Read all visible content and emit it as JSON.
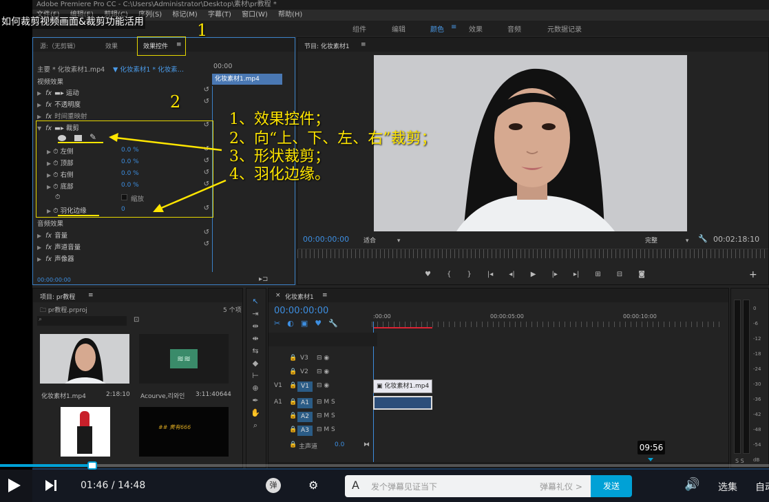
{
  "video_title": "如何裁剪视频画面&裁剪功能活用",
  "premiere": {
    "title": "Adobe Premiere Pro CC - C:\\Users\\Administrator\\Desktop\\素材\\pr教程 *",
    "menus": [
      "文件(F)",
      "编辑(E)",
      "剪辑(C)",
      "序列(S)",
      "标记(M)",
      "字幕(T)",
      "窗口(W)",
      "帮助(H)"
    ],
    "workspaces": [
      "组件",
      "编辑",
      "颜色",
      "≡",
      "效果",
      "音频",
      "元数据记录"
    ],
    "top_left_tabs": {
      "source": "源:（无剪辑）",
      "effects": "效果",
      "effect_controls": "效果控件",
      "menu": "≡"
    },
    "ec": {
      "master": "主要 * 化妆素材1.mp4",
      "clip": "▼ 化妆素材1 * 化妆素…",
      "time": "00:00",
      "clip_bar": "化妆素材1.mp4",
      "video_effects": "视频效果",
      "motion": "运动",
      "opacity": "不透明度",
      "time_remap": "时间重映射",
      "crop": "裁剪",
      "left": "左侧",
      "left_val": "0.0 %",
      "top": "顶部",
      "top_val": "0.0 %",
      "right": "右侧",
      "right_val": "0.0 %",
      "bottom": "底部",
      "bottom_val": "0.0 %",
      "zoom": "缩放",
      "feather": "羽化边缘",
      "feather_val": "0",
      "audio_effects": "音频效果",
      "volume": "音量",
      "channel_volume": "声道音量",
      "panner": "声像器",
      "timecode": "00:00:00:00",
      "fx": "fx"
    },
    "program": {
      "title": "节目: 化妆素材1",
      "menu": "≡",
      "timecode": "00:00:00:00",
      "fit": "适合",
      "quality": "完整",
      "duration": "00:02:18:10",
      "transport": [
        "♥",
        "{",
        "}",
        "|◂",
        "◂|",
        "▶",
        "|▸",
        "▸|",
        "⊞",
        "⊟",
        "◙"
      ],
      "plus": "+"
    },
    "project": {
      "title": "项目: pr教程",
      "menu": "≡",
      "file": "pr教程.prproj",
      "count": "5 个项",
      "items": [
        {
          "name": "化妆素材1.mp4",
          "dur": "2:18:10"
        },
        {
          "name": "Acourve,리와인",
          "dur": "3:11:40644"
        },
        {
          "name": "",
          "dur": ""
        },
        {
          "name": "",
          "dur": ""
        }
      ],
      "gold_text": "## 黄有666"
    },
    "timeline": {
      "title": "化妆素材1",
      "close": "×",
      "menu": "≡",
      "timecode": "00:00:00:00",
      "ruler": [
        ":00:00",
        "00:00:05:00",
        "00:00:10:00"
      ],
      "tracks": [
        {
          "name": "V3",
          "label": ""
        },
        {
          "name": "V2",
          "label": ""
        },
        {
          "name": "V1",
          "label": "V1"
        },
        {
          "name": "A1",
          "label": "A1"
        },
        {
          "name": "A2",
          "label": ""
        },
        {
          "name": "A3",
          "label": ""
        }
      ],
      "master": "主声道",
      "master_val": "0.0",
      "clip_name": "化妆素材1.mp4",
      "marker_time": "09:56"
    },
    "meter": [
      "0",
      "-6",
      "-12",
      "-18",
      "-24",
      "-30",
      "-36",
      "-42",
      "-48",
      "-54",
      "dB"
    ],
    "meter_ss": "S  S"
  },
  "annotations": {
    "num1": "1",
    "num2": "2",
    "line1": "1、效果控件；",
    "line2": "2、向“上、下、左、右”裁剪；",
    "line3": "3、形状裁剪；",
    "line4": "4、羽化边缘。"
  },
  "player": {
    "current": "01:46",
    "separator": "/",
    "total": "14:48",
    "danmaku_toggle": "弹",
    "danmaku_placeholder": "发个弹幕见证当下",
    "danmaku_etiquette": "弹幕礼仪 >",
    "send": "发送",
    "episodes": "选集",
    "auto": "自动",
    "progress_percent": 12.0
  },
  "colors": {
    "accent": "#00a1d6",
    "annotation": "#ffe600",
    "pr_blue": "#3d8ee0"
  }
}
